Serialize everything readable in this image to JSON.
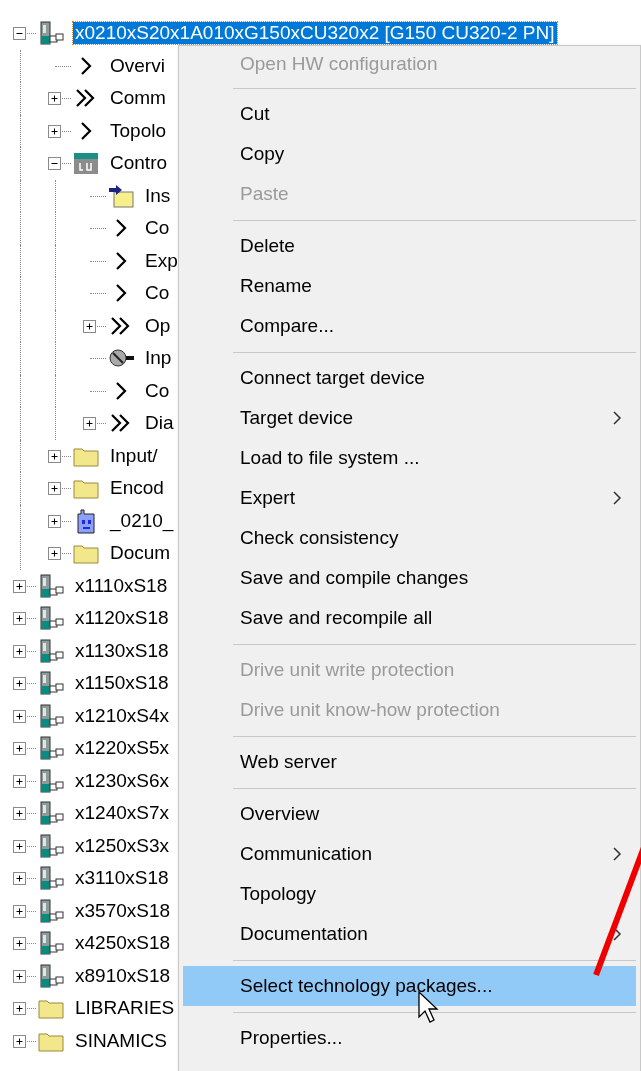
{
  "tree": [
    {
      "label": "x0210xS20x1A010xG150xCU320x2 [G150 CU320-2 PN]",
      "kind": "device",
      "expanded": true,
      "selected": true,
      "children": [
        {
          "label": "Overvi",
          "kind": "chevron",
          "selected": false
        },
        {
          "label": "Comm",
          "kind": "double-chevron",
          "expanded": false,
          "selected": false
        },
        {
          "label": "Topolo",
          "kind": "chevron",
          "expanded": false,
          "selected": false
        },
        {
          "label": "Contro",
          "kind": "cu",
          "expanded": true,
          "selected": false,
          "children": [
            {
              "label": "Ins",
              "kind": "insert",
              "selected": false
            },
            {
              "label": "Co",
              "kind": "chevron",
              "selected": false
            },
            {
              "label": "Exp",
              "kind": "chevron",
              "selected": false
            },
            {
              "label": "Co",
              "kind": "chevron",
              "selected": false
            },
            {
              "label": "Op",
              "kind": "double-chevron",
              "expanded": false,
              "selected": false
            },
            {
              "label": "Inp",
              "kind": "knob",
              "selected": false
            },
            {
              "label": "Co",
              "kind": "chevron",
              "selected": false
            },
            {
              "label": "Dia",
              "kind": "double-chevron",
              "expanded": false,
              "selected": false
            }
          ]
        },
        {
          "label": "Input/",
          "kind": "folder",
          "expanded": false,
          "selected": false
        },
        {
          "label": "Encod",
          "kind": "folder",
          "expanded": false,
          "selected": false
        },
        {
          "label": "_0210_",
          "kind": "drive",
          "expanded": false,
          "selected": false
        },
        {
          "label": "Docum",
          "kind": "folder",
          "expanded": false,
          "selected": false
        }
      ]
    },
    {
      "label": "x1110xS18",
      "kind": "device",
      "expanded": false,
      "selected": false
    },
    {
      "label": "x1120xS18",
      "kind": "device",
      "expanded": false,
      "selected": false
    },
    {
      "label": "x1130xS18",
      "kind": "device",
      "expanded": false,
      "selected": false
    },
    {
      "label": "x1150xS18",
      "kind": "device",
      "expanded": false,
      "selected": false
    },
    {
      "label": "x1210xS4x",
      "kind": "device",
      "expanded": false,
      "selected": false
    },
    {
      "label": "x1220xS5x",
      "kind": "device",
      "expanded": false,
      "selected": false
    },
    {
      "label": "x1230xS6x",
      "kind": "device",
      "expanded": false,
      "selected": false
    },
    {
      "label": "x1240xS7x",
      "kind": "device",
      "expanded": false,
      "selected": false
    },
    {
      "label": "x1250xS3x",
      "kind": "device",
      "expanded": false,
      "selected": false
    },
    {
      "label": "x3110xS18",
      "kind": "device",
      "expanded": false,
      "selected": false
    },
    {
      "label": "x3570xS18",
      "kind": "device",
      "expanded": false,
      "selected": false
    },
    {
      "label": "x4250xS18",
      "kind": "device",
      "expanded": false,
      "selected": false
    },
    {
      "label": "x8910xS18",
      "kind": "device",
      "expanded": false,
      "selected": false
    },
    {
      "label": "LIBRARIES",
      "kind": "folder",
      "expanded": false,
      "selected": false
    },
    {
      "label": "SINAMICS",
      "kind": "folder",
      "expanded": false,
      "selected": false
    }
  ],
  "context_menu": [
    {
      "kind": "item",
      "label": "Open HW configuration",
      "disabled": true,
      "selected": false
    },
    {
      "kind": "separator"
    },
    {
      "kind": "item",
      "label": "Cut",
      "disabled": false,
      "selected": false
    },
    {
      "kind": "item",
      "label": "Copy",
      "disabled": false,
      "selected": false
    },
    {
      "kind": "item",
      "label": "Paste",
      "disabled": true,
      "selected": false
    },
    {
      "kind": "separator"
    },
    {
      "kind": "item",
      "label": "Delete",
      "disabled": false,
      "selected": false
    },
    {
      "kind": "item",
      "label": "Rename",
      "disabled": false,
      "selected": false
    },
    {
      "kind": "item",
      "label": "Compare...",
      "disabled": false,
      "selected": false
    },
    {
      "kind": "separator"
    },
    {
      "kind": "item",
      "label": "Connect target device",
      "disabled": false,
      "selected": false
    },
    {
      "kind": "item",
      "label": "Target device",
      "disabled": false,
      "submenu": true,
      "selected": false
    },
    {
      "kind": "item",
      "label": "Load to file system ...",
      "disabled": false,
      "selected": false
    },
    {
      "kind": "item",
      "label": "Expert",
      "disabled": false,
      "submenu": true,
      "selected": false
    },
    {
      "kind": "item",
      "label": "Check consistency",
      "disabled": false,
      "selected": false
    },
    {
      "kind": "item",
      "label": "Save and compile changes",
      "disabled": false,
      "selected": false
    },
    {
      "kind": "item",
      "label": "Save and recompile all",
      "disabled": false,
      "selected": false
    },
    {
      "kind": "separator"
    },
    {
      "kind": "item",
      "label": "Drive unit write protection",
      "disabled": true,
      "selected": false
    },
    {
      "kind": "item",
      "label": "Drive unit know-how protection",
      "disabled": true,
      "selected": false
    },
    {
      "kind": "separator"
    },
    {
      "kind": "item",
      "label": "Web server",
      "disabled": false,
      "selected": false
    },
    {
      "kind": "separator"
    },
    {
      "kind": "item",
      "label": "Overview",
      "disabled": false,
      "selected": false
    },
    {
      "kind": "item",
      "label": "Communication",
      "disabled": false,
      "submenu": true,
      "selected": false
    },
    {
      "kind": "item",
      "label": "Topology",
      "disabled": false,
      "selected": false
    },
    {
      "kind": "item",
      "label": "Documentation",
      "disabled": false,
      "submenu": true,
      "selected": false
    },
    {
      "kind": "separator"
    },
    {
      "kind": "item",
      "label": "Select technology packages...",
      "disabled": false,
      "selected": true
    },
    {
      "kind": "separator"
    },
    {
      "kind": "item",
      "label": "Properties...",
      "disabled": false,
      "selected": false
    }
  ]
}
